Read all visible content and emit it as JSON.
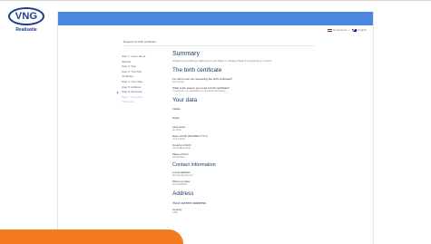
{
  "logo": {
    "brand": "VNG",
    "sub": "Realisatie"
  },
  "header": {
    "languages": [
      {
        "label": "Nederlands",
        "flag_icon": "flag-nl-icon"
      },
      {
        "label": "English",
        "flag_icon": "flag-en-icon"
      }
    ],
    "separator": "/"
  },
  "form": {
    "title": "Request for birth certificate"
  },
  "steps": [
    {
      "label": "Step 1: Learn about"
    },
    {
      "label": "Sample"
    },
    {
      "label": "Step 2: Sign"
    },
    {
      "label": "Step 3: The birth"
    },
    {
      "label": "certificate"
    },
    {
      "label": "Step 4: Your data"
    },
    {
      "label": "Step 5: Address"
    },
    {
      "label": "Step 6: Summary",
      "state": "active"
    },
    {
      "label": "Step 7: Overview",
      "state": "future"
    },
    {
      "label": "Thank you",
      "state": "future"
    }
  ],
  "summary": {
    "title": "Summary",
    "lead": "Check if everything is still correct you filled in. Please check if everything is correct.",
    "birth_certificate": {
      "title": "The birth certificate",
      "q1": "For whom are you requesting the birth certificate?",
      "a1": "For myself",
      "q2": "What is the reason you need a birth certificate?",
      "a2": "I need it for my application to the Dutch Embassy"
    },
    "your_data": {
      "title": "Your data",
      "fields": [
        {
          "label": "Initials",
          "value": ""
        },
        {
          "label": "Prefix",
          "value": ""
        },
        {
          "label": "Last name",
          "value": "de Vries"
        },
        {
          "label": "Date of birth (DD-MM-YYYY)",
          "value": "01-01-1970"
        },
        {
          "label": "Country of birth",
          "value": "The Netherlands"
        },
        {
          "label": "Place of birth",
          "value": "Amsterdam"
        }
      ]
    },
    "contact": {
      "title": "Contact information",
      "fields": [
        {
          "label": "e-mail address",
          "value": "jdevries@mail.com"
        },
        {
          "label": "Phone number",
          "value": "06-12345678"
        }
      ]
    },
    "address": {
      "title": "Address",
      "subtitle": "Your current address",
      "fields": [
        {
          "label": "Country",
          "value": "Chile"
        }
      ]
    }
  },
  "colors": {
    "header_blue": "#4b87e0",
    "accent_orange": "#f47a20",
    "brand_navy": "#1e3f8f"
  }
}
